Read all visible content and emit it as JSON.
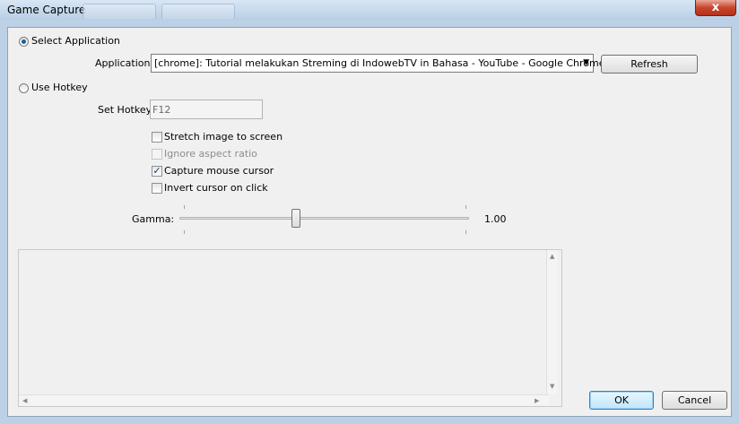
{
  "window": {
    "title": "Game Capture",
    "close_glyph": "x"
  },
  "select_app": {
    "label": "Select Application",
    "checked": true
  },
  "application": {
    "label": "Application:",
    "value": "[chrome]: Tutorial melakukan Streming di IndowebTV in Bahasa - YouTube - Google Chrome",
    "dropdown_icon": "chevron-down-icon"
  },
  "refresh_label": "Refresh",
  "use_hotkey": {
    "label": "Use Hotkey",
    "checked": false
  },
  "hotkey": {
    "label": "Set Hotkey",
    "value": "F12"
  },
  "checkboxes": [
    {
      "label": "Stretch image to screen",
      "checked": false,
      "enabled": true
    },
    {
      "label": "Ignore aspect ratio",
      "checked": false,
      "enabled": false
    },
    {
      "label": "Capture mouse cursor",
      "checked": true,
      "enabled": true
    },
    {
      "label": "Invert cursor on click",
      "checked": false,
      "enabled": true
    }
  ],
  "gamma": {
    "label": "Gamma:",
    "value_text": "1.00",
    "fraction": 0.4
  },
  "ok_label": "OK",
  "cancel_label": "Cancel",
  "check_glyph": "✓"
}
